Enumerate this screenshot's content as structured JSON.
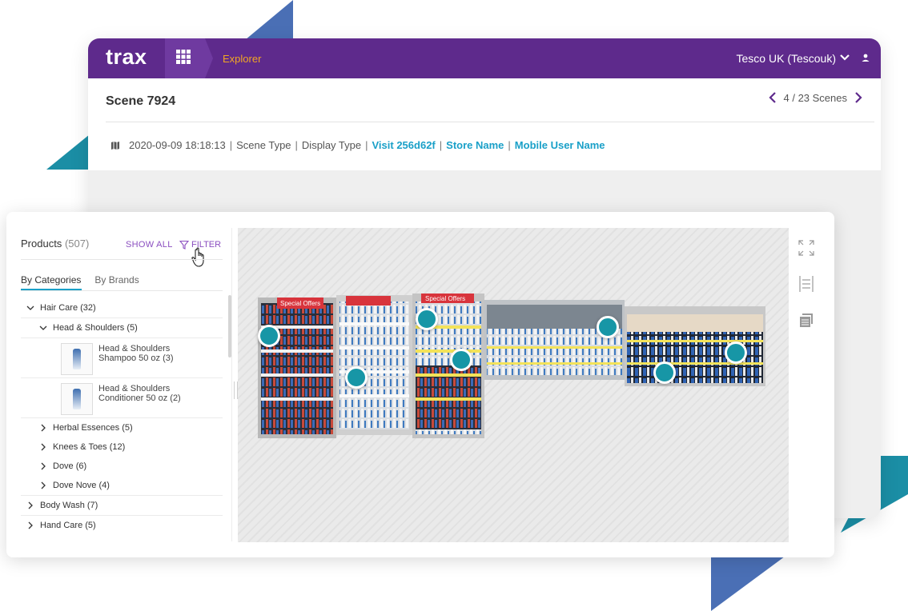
{
  "app": {
    "brand": "trax",
    "breadcrumb": "Explorer",
    "account": "Tesco UK (Tescouk)"
  },
  "scene": {
    "title": "Scene 7924",
    "pager": "4 / 23 Scenes",
    "meta": {
      "datetime": "2020-09-09 18:18:13",
      "scene_type": "Scene Type",
      "display_type": "Display Type",
      "visit": "Visit 256d62f",
      "store": "Store Name",
      "mobile_user": "Mobile User Name",
      "separator": "|"
    }
  },
  "products": {
    "title": "Products",
    "count": "(507)",
    "show_all": "SHOW ALL",
    "filter": "FILTER",
    "tabs": [
      "By Categories",
      "By Brands"
    ],
    "tree": {
      "hair_care": "Hair Care (32)",
      "head_shoulders": "Head & Shoulders (5)",
      "product1_line1": "Head & Shoulders",
      "product1_line2": "Shampoo 50 oz (3)",
      "product2_line1": "Head & Shoulders",
      "product2_line2": "Conditioner 50 oz (2)",
      "herbal": "Herbal Essences (5)",
      "knees": "Knees & Toes (12)",
      "dove": "Dove (6)",
      "dove_nove": "Dove Nove (4)",
      "body_wash": "Body Wash (7)",
      "hand_care": "Hand Care (5)"
    }
  },
  "shelf_labels": {
    "special1": "Special Offers",
    "special2": "Special Offers",
    "special3": "Special Offers"
  },
  "colors": {
    "topbar": "#5e2a8c",
    "accent_orange": "#f2a623",
    "link_blue": "#1aa0c8",
    "marker_teal": "#1796a6",
    "purple_link": "#8b4fc0"
  },
  "icons": [
    "grid-icon",
    "chevron-down-icon",
    "user-icon",
    "chevron-left-icon",
    "chevron-right-icon",
    "map-icon",
    "filter-icon",
    "hand-cursor-icon",
    "expand-icon",
    "list-icon",
    "copy-icon"
  ]
}
